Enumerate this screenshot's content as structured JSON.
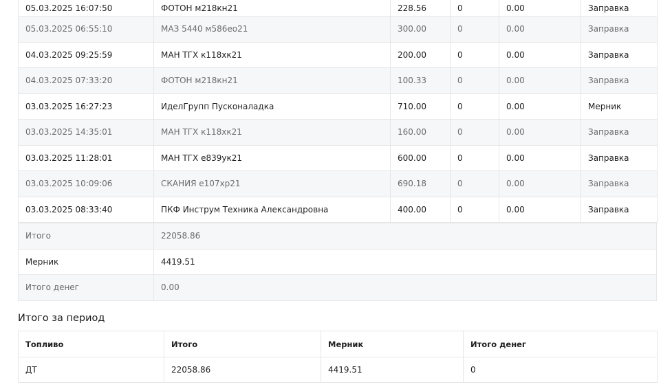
{
  "transactions": [
    {
      "datetime": "05.03.2025 16:07:50",
      "name": "ФОТОН м218кн21",
      "volume": "228.56",
      "col4": "0",
      "col5": "0.00",
      "type": "Заправка"
    },
    {
      "datetime": "05.03.2025 06:55:10",
      "name": "МАЗ 5440 м586ео21",
      "volume": "300.00",
      "col4": "0",
      "col5": "0.00",
      "type": "Заправка"
    },
    {
      "datetime": "04.03.2025 09:25:59",
      "name": "МАН ТГХ к118хк21",
      "volume": "200.00",
      "col4": "0",
      "col5": "0.00",
      "type": "Заправка"
    },
    {
      "datetime": "04.03.2025 07:33:20",
      "name": "ФОТОН м218кн21",
      "volume": "100.33",
      "col4": "0",
      "col5": "0.00",
      "type": "Заправка"
    },
    {
      "datetime": "03.03.2025 16:27:23",
      "name": "ИделГрупп Пусконаладка",
      "volume": "710.00",
      "col4": "0",
      "col5": "0.00",
      "type": "Мерник"
    },
    {
      "datetime": "03.03.2025 14:35:01",
      "name": "МАН ТГХ к118хк21",
      "volume": "160.00",
      "col4": "0",
      "col5": "0.00",
      "type": "Заправка"
    },
    {
      "datetime": "03.03.2025 11:28:01",
      "name": "МАН ТГХ е839ук21",
      "volume": "600.00",
      "col4": "0",
      "col5": "0.00",
      "type": "Заправка"
    },
    {
      "datetime": "03.03.2025 10:09:06",
      "name": "СКАНИЯ е107хр21",
      "volume": "690.18",
      "col4": "0",
      "col5": "0.00",
      "type": "Заправка"
    },
    {
      "datetime": "03.03.2025 08:33:40",
      "name": "ПКФ Инструм Техника Александровна",
      "volume": "400.00",
      "col4": "0",
      "col5": "0.00",
      "type": "Заправка"
    }
  ],
  "totals": [
    {
      "label": "Итого",
      "value": "22058.86"
    },
    {
      "label": "Мерник",
      "value": "4419.51"
    },
    {
      "label": "Итого денег",
      "value": "0.00"
    }
  ],
  "period": {
    "title": "Итого за период",
    "headers": {
      "fuel": "Топливо",
      "total": "Итого",
      "meter": "Мерник",
      "money": "Итого денег"
    },
    "rows": [
      {
        "fuel": "ДТ",
        "total": "22058.86",
        "meter": "4419.51",
        "money": "0"
      }
    ]
  }
}
